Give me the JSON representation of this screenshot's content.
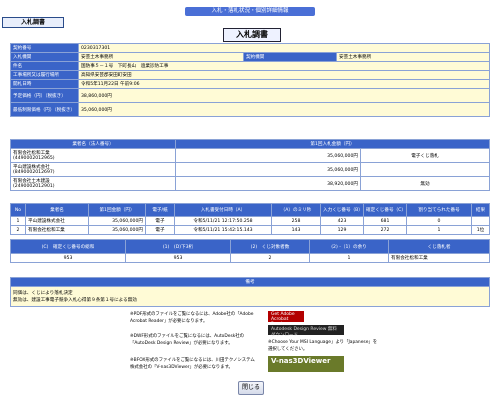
{
  "header": {
    "topbar": "入札・落札状況・個別詳細情報",
    "tag": "入札調書",
    "title": "入札調書"
  },
  "info": [
    {
      "label": "契約番号",
      "value": "0230317301"
    },
    {
      "label": "入札機関",
      "value": "安芸土木事務所",
      "label2": "契約機関",
      "value2": "安芸土木事務所"
    },
    {
      "label": "件名",
      "value": "国防事５－１号　下町長山　過業診防工事"
    },
    {
      "label": "工事場所又は履行場所",
      "value": "高知県安芸郡安田町安田"
    },
    {
      "label": "開札日時",
      "value": "令和5年11月22日 午前9:06"
    },
    {
      "label": "予定価格（円）（税抜き）",
      "value": "38,860,000円"
    },
    {
      "label": "最低制限価格（円）（税抜き）",
      "value": "35,060,000円"
    }
  ],
  "bids": {
    "headers": [
      "業者名（法人番号）",
      "第1回入札金額（円）"
    ],
    "rows": [
      {
        "name": "有限会社松和工業",
        "id": "(4490002012965)",
        "amount": "35,060,000円",
        "note": "電子くじ落札"
      },
      {
        "name": "平山建設株式会社",
        "id": "(8490002012697)",
        "amount": "35,060,000円",
        "note": ""
      },
      {
        "name": "有限会社土木建設",
        "id": "(2490002012901)",
        "amount": "38,920,000円",
        "note": "無効"
      }
    ]
  },
  "lottery": {
    "headers": [
      "No",
      "業者名",
      "第1回金額（円）",
      "電子/紙",
      "入札書受付日時（A）",
      "（A）のミリ秒",
      "入力くじ番号（B）",
      "確定くじ番号（C）",
      "割り当てられた番号",
      "結果"
    ],
    "rows": [
      {
        "no": "1",
        "name": "平山建設株式会社",
        "amount": "35,060,000円",
        "type": "電子",
        "time": "令和5/11/21 12:17:50.258",
        "ms": "258",
        "input": "423",
        "fixed": "681",
        "assigned": "0",
        "result": ""
      },
      {
        "no": "2",
        "name": "有限会社松和工業",
        "amount": "35,060,000円",
        "type": "電子",
        "time": "令和5/11/21 15:42:15.143",
        "ms": "143",
        "input": "129",
        "fixed": "272",
        "assigned": "1",
        "result": "1位"
      }
    ]
  },
  "calc": {
    "headers": [
      "(C)　確定くじ番号の総和",
      "(1)　(D)下3桁",
      "(2)　くじ対象者数",
      "(2) -（1）の余り",
      "くじ落札者"
    ],
    "values": [
      "953",
      "953",
      "2",
      "1",
      "有限会社松和工業"
    ]
  },
  "remarks": {
    "header": "備考",
    "lines": [
      "同価は、くじにより落札決定",
      "無効は、建設工事電子競争入札心得第９条第１号による無効"
    ]
  },
  "notes": [
    "※PDF形式のファイルをご覧になるには、Adobe社の「Adobe Acrobat Reader」が必要になります。",
    "※DWF形式のファイルをご覧になるには、AutoDesk社の「AutoDesk Design Review」が必要になります。",
    "※Choose Your MSI Language」より「Japanese」を選択してください。",
    "※BFOX形式のファイルをご覧になるには、川田テクノシステム株式会社の「V-nas3DViewer」が必要になります。"
  ],
  "badges": {
    "acrobat": "Get Adobe Acrobat Reader",
    "autodesk": "Autodesk Design Review 無料ダウンロード",
    "vnas": "V-nas3DViewer"
  },
  "close_label": "閉じる"
}
